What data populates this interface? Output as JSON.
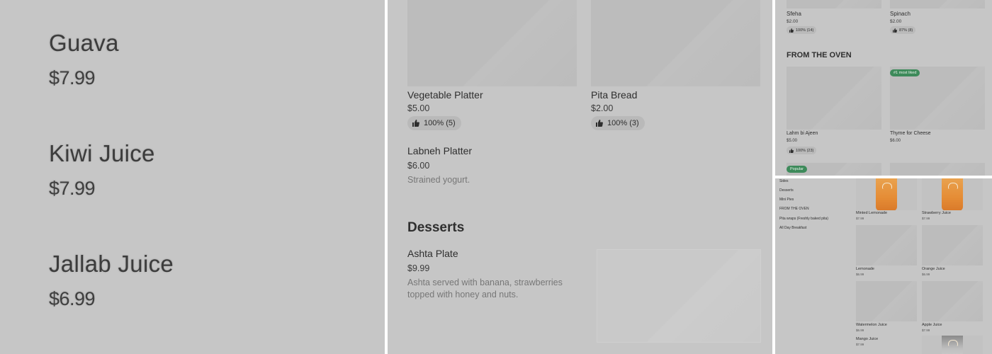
{
  "panel_zoom": {
    "items": [
      {
        "name": "Guava",
        "price": "$7.99"
      },
      {
        "name": "Kiwi Juice",
        "price": "$7.99"
      },
      {
        "name": "Jallab Juice",
        "price": "$6.99"
      }
    ]
  },
  "panel_menu": {
    "items": [
      {
        "name": "Vegetable Platter",
        "price": "$5.00",
        "rating": "100% (5)"
      },
      {
        "name": "Pita Bread",
        "price": "$2.00",
        "rating": "100% (3)"
      }
    ],
    "labneh": {
      "name": "Labneh Platter",
      "price": "$6.00",
      "description": "Strained yogurt."
    },
    "desserts_heading": "Desserts",
    "ashta": {
      "name": "Ashta Plate",
      "price": "$9.99",
      "description": "Ashta served with banana, strawberries topped with honey and nuts."
    }
  },
  "panel_oven": {
    "top_items": [
      {
        "name": "Sfeha",
        "price": "$2.00",
        "rating": "100% (14)"
      },
      {
        "name": "Spinach",
        "price": "$2.00",
        "rating": "87% (8)"
      }
    ],
    "heading": "FROM THE OVEN",
    "items": [
      {
        "name": "Lahm bi Ajeen",
        "price": "$5.00",
        "rating": "100% (23)"
      },
      {
        "name": "Thyme for Cheese",
        "price": "$6.00",
        "badge": "#1 most liked"
      }
    ],
    "popular_badge": "Popular"
  },
  "panel_drinks": {
    "sidebar": [
      "Sides",
      "Desserts",
      "Mini Pies",
      "FROM THE OVEN",
      "Pita wraps (Freshly baked pita)",
      "All Day Breakfast"
    ],
    "items": [
      {
        "name": "Minted Lemonade",
        "price": "$7.99"
      },
      {
        "name": "Strawberry Juice",
        "price": "$7.99"
      },
      {
        "name": "Lemonade",
        "price": "$6.99"
      },
      {
        "name": "Orange Juice",
        "price": "$6.99"
      },
      {
        "name": "Watermelon Juice",
        "price": "$6.99"
      },
      {
        "name": "Apple Juice",
        "price": "$7.99"
      },
      {
        "name": "Mango Juice",
        "price": "$7.99"
      }
    ]
  },
  "colors": {
    "background": "#c6c6c6",
    "badge_green": "#3d8a5a"
  },
  "icons": {
    "rating": "thumbs-up-icon"
  }
}
